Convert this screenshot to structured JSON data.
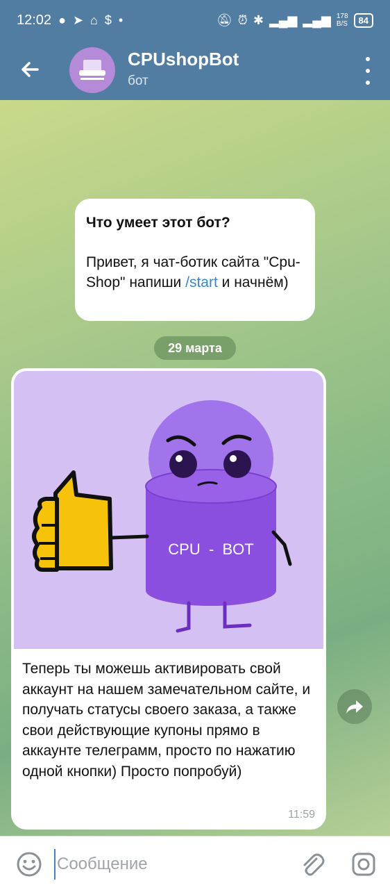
{
  "statusbar": {
    "time": "12:02",
    "net_speed": "178\nB/S",
    "battery": "84"
  },
  "header": {
    "back_icon": "arrow-left-icon",
    "title": "CPUshopBot",
    "subtitle": "бот",
    "menu_icon": "more-vert-icon"
  },
  "bot_info": {
    "heading": "Что умеет этот бот?",
    "text_before": "Привет, я чат-ботик сайта \"Cpu-Shop\" напиши ",
    "command": "/start",
    "text_after": " и начнём)"
  },
  "date_separator": "29 марта",
  "message": {
    "image_label": "CPU  -  BOT",
    "text": "Теперь ты можешь активировать свой аккаунт на нашем замечательном сайте, и получать статусы своего заказа, а также свои действующие купоны прямо в аккаунте телеграмм, просто по нажатию одной кнопки) Просто попробуй)",
    "time": "11:59"
  },
  "input": {
    "placeholder": "Сообщение"
  },
  "colors": {
    "header_bg": "#527da3",
    "link": "#3a87c8",
    "image_bg": "#d4c0f2",
    "mascot": "#8b4fe0"
  }
}
